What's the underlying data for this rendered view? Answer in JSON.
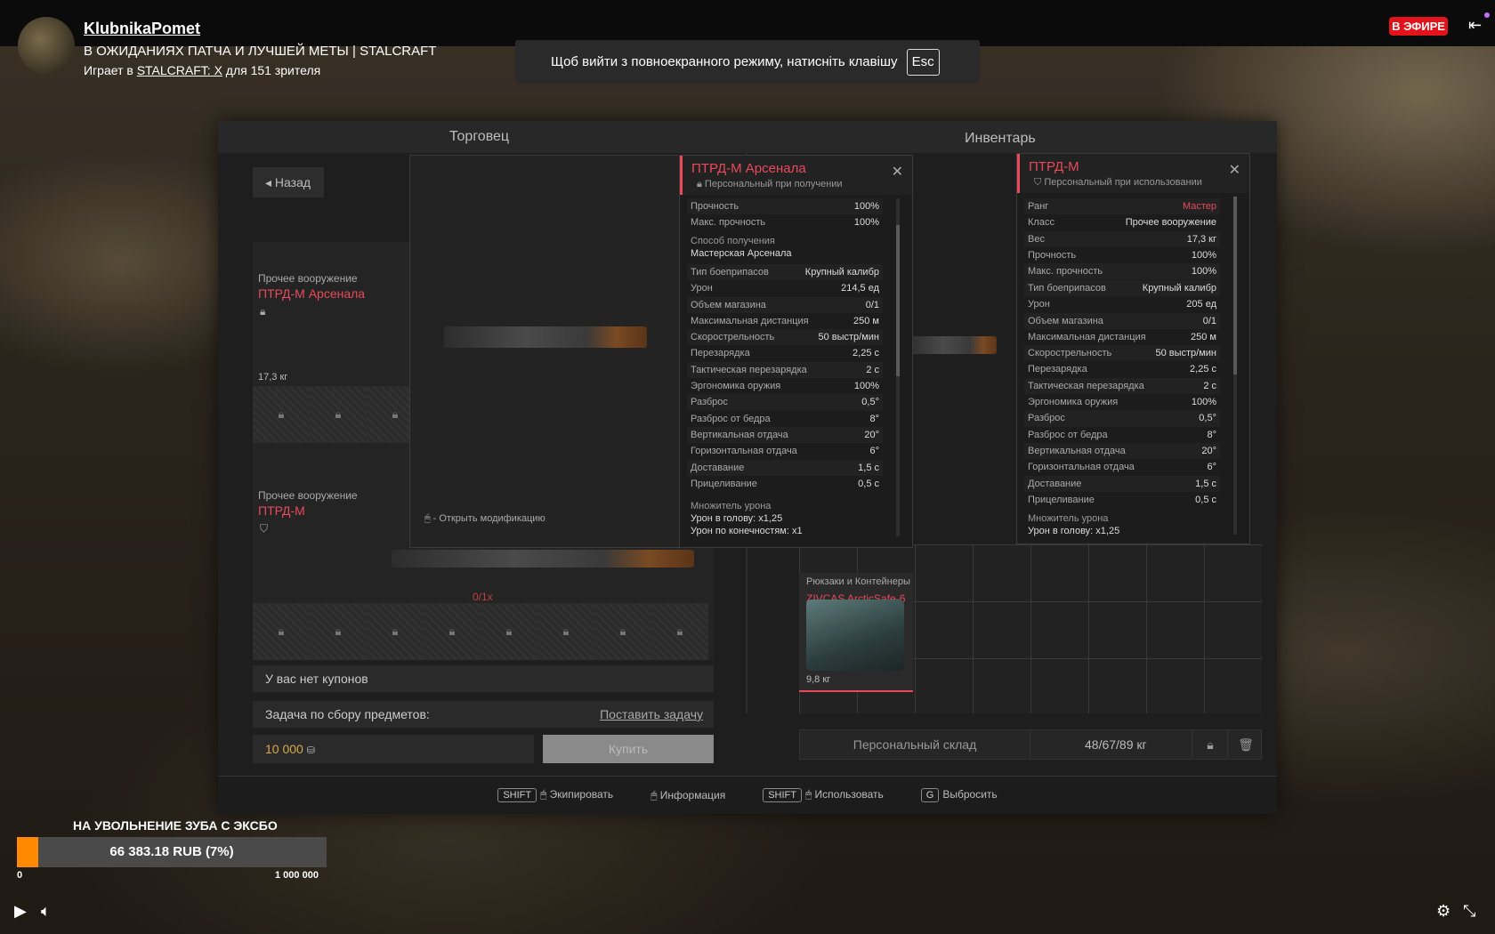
{
  "stream": {
    "channel": "KlubnikaPomet",
    "title": "В ОЖИДАНИЯХ ПАТЧА И ЛУЧШЕЙ МЕТЫ | STALCRAFT",
    "playing_prefix": "Играет в",
    "game": "STALCRAFT: X",
    "viewers_text": "для 151 зрителя",
    "live_badge": "В ЭФИРЕ"
  },
  "toast": {
    "text": "Щоб вийти з повноекранного режиму, натисніть клавішу",
    "key": "Esc"
  },
  "game": {
    "tab_trader": "Торговец",
    "tab_inventory": "Инвентарь",
    "back": "Назад",
    "item1": {
      "category": "Прочее вооружение",
      "name": "ПТРД-М Арсенала",
      "weight": "17,3 кг"
    },
    "item2": {
      "category": "Прочее вооружение",
      "name": "ПТРД-М",
      "ammo": "0/1x"
    },
    "no_coupons": "У вас нет купонов",
    "task_label": "Задача по сбору предметов:",
    "task_button": "Поставить задачу",
    "price": "10 000",
    "buy": "Купить",
    "open_mods": "- Открыть модификацию",
    "tooltip_left": {
      "name": "ПТРД-М Арсенала",
      "binding": "Персональный при получении",
      "durability": [
        [
          "Прочность",
          "100%"
        ],
        [
          "Макс. прочность",
          "100%"
        ]
      ],
      "source_label": "Способ получения",
      "source_value": "Мастерская Арсенала",
      "stats": [
        [
          "Тип боеприпасов",
          "Крупный калибр"
        ],
        [
          "Урон",
          "214,5 ед"
        ],
        [
          "Объем магазина",
          "0/1"
        ],
        [
          "Максимальная дистанция",
          "250 м"
        ],
        [
          "Скорострельность",
          "50 выстр/мин"
        ],
        [
          "Перезарядка",
          "2,25 с"
        ],
        [
          "Тактическая перезарядка",
          "2 с"
        ],
        [
          "Эргономика оружия",
          "100%"
        ],
        [
          "Разброс",
          "0,5°"
        ],
        [
          "Разброс от бедра",
          "8°"
        ],
        [
          "Вертикальная отдача",
          "20°"
        ],
        [
          "Горизонтальная отдача",
          "6°"
        ],
        [
          "Доставание",
          "1,5 с"
        ],
        [
          "Прицеливание",
          "0,5 с"
        ]
      ],
      "mult_label": "Множитель урона",
      "mult_head": "Урон в голову: x1,25",
      "mult_limbs": "Урон по конечностям: x1"
    },
    "tooltip_right": {
      "name": "ПТРД-М",
      "binding": "Персональный при использовании",
      "info": [
        [
          "Ранг",
          "Мастер"
        ],
        [
          "Класс",
          "Прочее вооружение"
        ],
        [
          "Вес",
          "17,3 кг"
        ],
        [
          "Прочность",
          "100%"
        ],
        [
          "Макс. прочность",
          "100%"
        ]
      ],
      "stats": [
        [
          "Тип боеприпасов",
          "Крупный калибр"
        ],
        [
          "Урон",
          "205 ед"
        ],
        [
          "Объем магазина",
          "0/1"
        ],
        [
          "Максимальная дистанция",
          "250 м"
        ],
        [
          "Скорострельность",
          "50 выстр/мин"
        ],
        [
          "Перезарядка",
          "2,25 с"
        ],
        [
          "Тактическая перезарядка",
          "2 с"
        ],
        [
          "Эргономика оружия",
          "100%"
        ],
        [
          "Разброс",
          "0,5°"
        ],
        [
          "Разброс от бедра",
          "8°"
        ],
        [
          "Вертикальная отдача",
          "20°"
        ],
        [
          "Горизонтальная отдача",
          "6°"
        ],
        [
          "Доставание",
          "1,5 с"
        ],
        [
          "Прицеливание",
          "0,5 с"
        ]
      ],
      "mult_label": "Множитель урона",
      "mult_head": "Урон в голову: x1,25"
    },
    "inv_item": {
      "category": "Рюкзаки и Контейнеры",
      "name": "ZIVCAS ArcticSafe-6",
      "weight": "9,8 кг"
    },
    "storage": "Персональный склад",
    "weight_total": "48/67/89 кг",
    "hotbar": [
      {
        "key": "SHIFT",
        "label": "Экипировать"
      },
      {
        "key": "",
        "label": "Информация"
      },
      {
        "key": "SHIFT",
        "label": "Использовать"
      },
      {
        "key": "G",
        "label": "Выбросить"
      }
    ]
  },
  "donation": {
    "title": "НА УВОЛЬНЕНИЕ ЗУБА С ЭКСБО",
    "amount": "66 383.18 RUB (7%)",
    "progress": 0.07,
    "min": "0",
    "max": "1 000 000"
  }
}
